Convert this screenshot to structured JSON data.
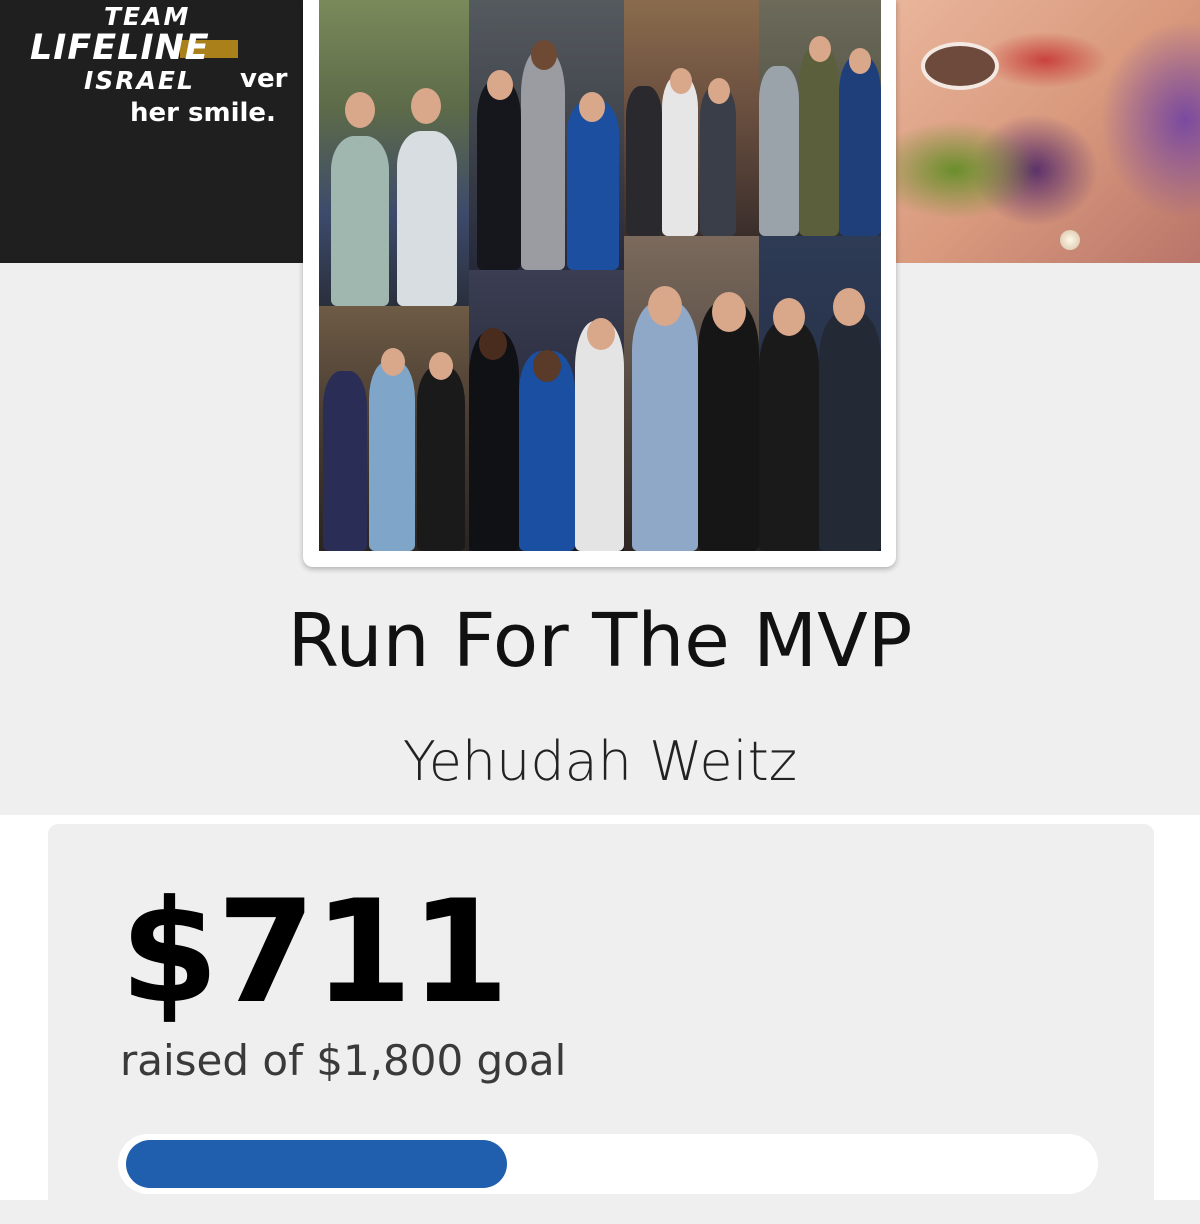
{
  "banner": {
    "logo_team": "TEAM",
    "logo_lifeline": "LIFELINE",
    "logo_israel": "ISRAEL",
    "tagline_partial": "ver",
    "tagline": "her smile."
  },
  "campaign": {
    "title": "Run For The MVP",
    "owner": "Yehudah Weitz"
  },
  "fundraising": {
    "raised": "$711",
    "goal_text": "raised of $1,800 goal",
    "raised_value": 711,
    "goal_value": 1800,
    "progress_fraction": 0.395
  },
  "colors": {
    "progress": "#1f5fae",
    "page_bg": "#efefef"
  }
}
